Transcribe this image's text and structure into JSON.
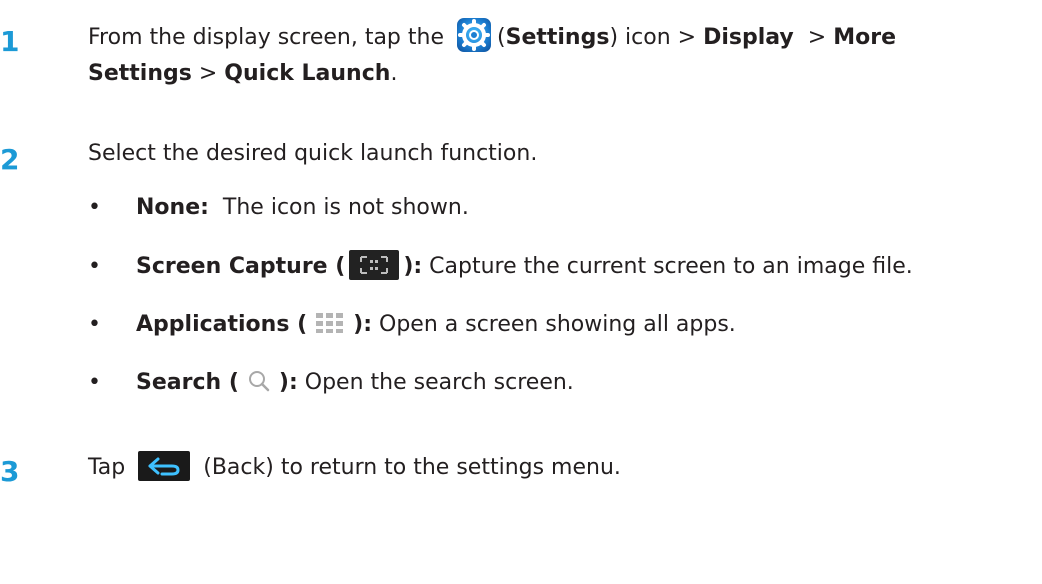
{
  "steps": [
    {
      "number": "1",
      "line1": {
        "prefix": "From the display screen, tap the",
        "paren_open": "(",
        "settings": "Settings",
        "mid1": ") icon >",
        "display": "Display",
        "sep": ">",
        "more": "More"
      },
      "line2": {
        "settings": "Settings",
        "sep": ">",
        "quick": "Quick Launch",
        "end": "."
      },
      "icon": "settings-gear-icon"
    },
    {
      "number": "2",
      "text": "Select the desired quick launch function.",
      "bullets": [
        {
          "label": "None:",
          "desc": "The icon is not shown."
        },
        {
          "label_open": "Screen Capture (",
          "label_close": "):",
          "desc": "Capture the current screen to an image file.",
          "icon": "screen-capture-icon"
        },
        {
          "label_open": "Applications (",
          "label_close": "):",
          "desc": "Open a screen showing all apps.",
          "icon": "apps-grid-icon"
        },
        {
          "label_open": "Search (",
          "label_close": "):",
          "desc": "Open the search screen.",
          "icon": "search-icon"
        }
      ]
    },
    {
      "number": "3",
      "prefix": "Tap",
      "suffix": "(Back) to return to the settings menu.",
      "icon": "back-icon"
    }
  ],
  "colors": {
    "step_number": "#1c9ad6",
    "text": "#231f20"
  }
}
